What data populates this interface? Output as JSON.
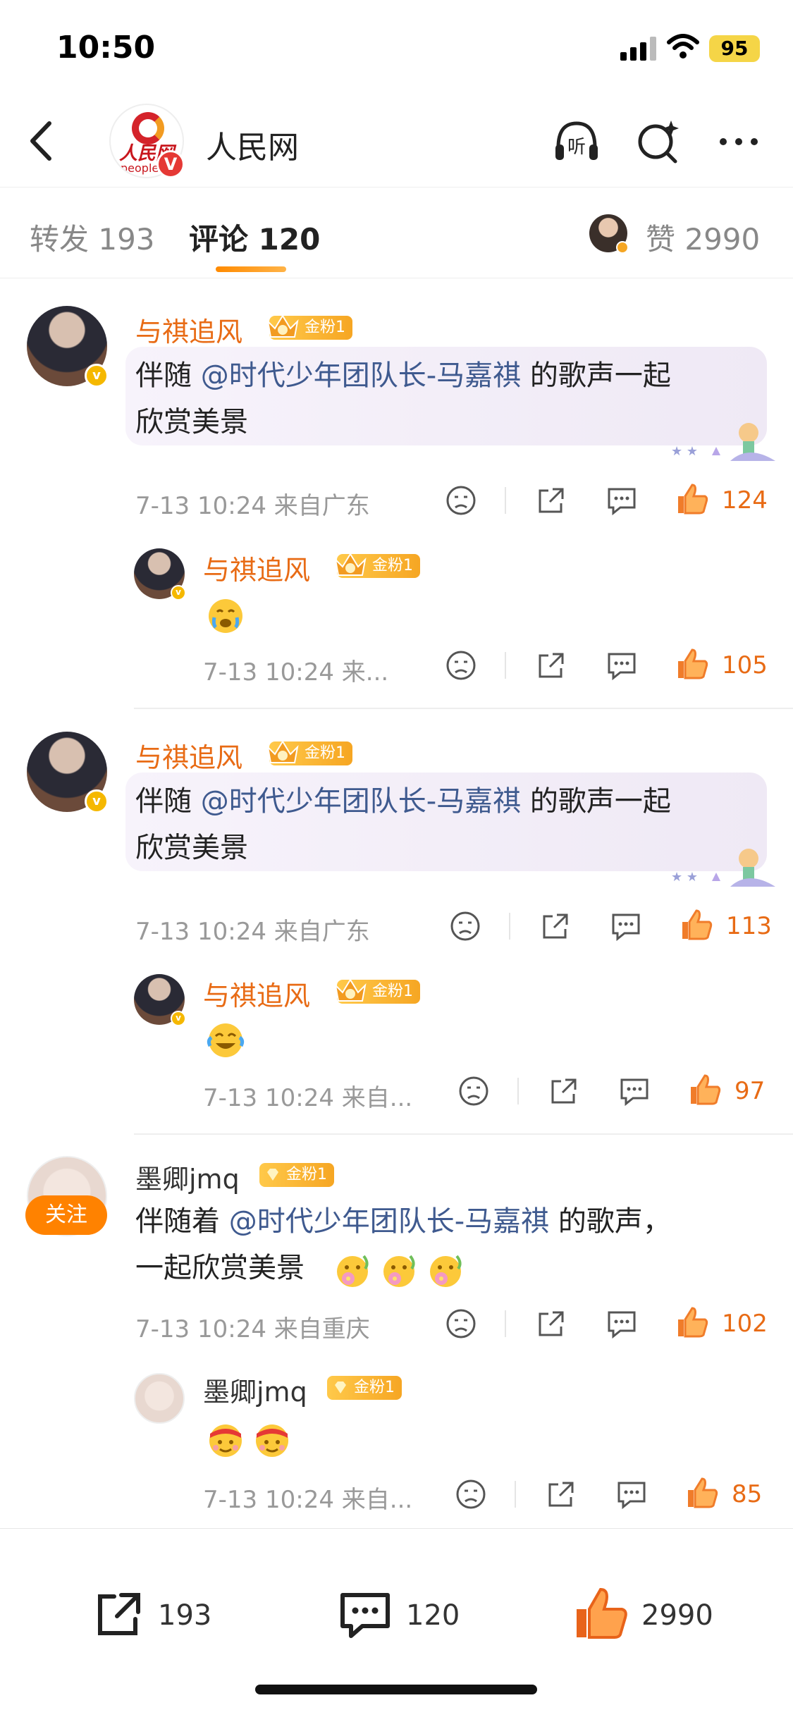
{
  "status": {
    "time": "10:50",
    "battery": "95"
  },
  "header": {
    "account_name": "人民网",
    "logo_word": "人民网",
    "logo_sub": "people"
  },
  "tabs": {
    "repost_label": "转发 193",
    "comment_label": "评论 120",
    "like_label": "赞 2990"
  },
  "comments": [
    {
      "username": "与祺追风",
      "badge": "金粉1",
      "text_pre": "伴随",
      "mention": "@时代少年团队长-马嘉祺",
      "text_post": "的歌声一起",
      "text_line2": "欣赏美景",
      "meta": "7-13 10:24  来自广东",
      "likes": "124",
      "reply": {
        "username": "与祺追风",
        "badge": "金粉1",
        "meta": "7-13 10:24  来...",
        "likes": "105",
        "emoji": "crying-laugh"
      }
    },
    {
      "username": "与祺追风",
      "badge": "金粉1",
      "text_pre": "伴随",
      "mention": "@时代少年团队长-马嘉祺",
      "text_post": "的歌声一起",
      "text_line2": "欣赏美景",
      "meta": "7-13 10:24  来自广东",
      "likes": "113",
      "reply": {
        "username": "与祺追风",
        "badge": "金粉1",
        "meta": "7-13 10:24  来自...",
        "likes": "97",
        "emoji": "laughing-tears"
      }
    },
    {
      "username": "墨卿jmq",
      "badge": "金粉1",
      "follow_label": "关注",
      "text_pre": "伴随着",
      "mention": "@时代少年团队长-马嘉祺",
      "text_post": "的歌声，",
      "text_line2": "一起欣赏美景",
      "meta": "7-13 10:24  来自重庆",
      "likes": "102",
      "reply": {
        "username": "墨卿jmq",
        "badge": "金粉1",
        "meta": "7-13 10:24  来自...",
        "likes": "85",
        "emoji": "headband-face"
      }
    }
  ],
  "bottom_bar": {
    "reposts": "193",
    "comments": "120",
    "likes": "2990"
  },
  "colors": {
    "accent": "#e86b15",
    "mention": "#3f5a8f",
    "follow": "#ff8200",
    "badge": "#f6a623"
  }
}
